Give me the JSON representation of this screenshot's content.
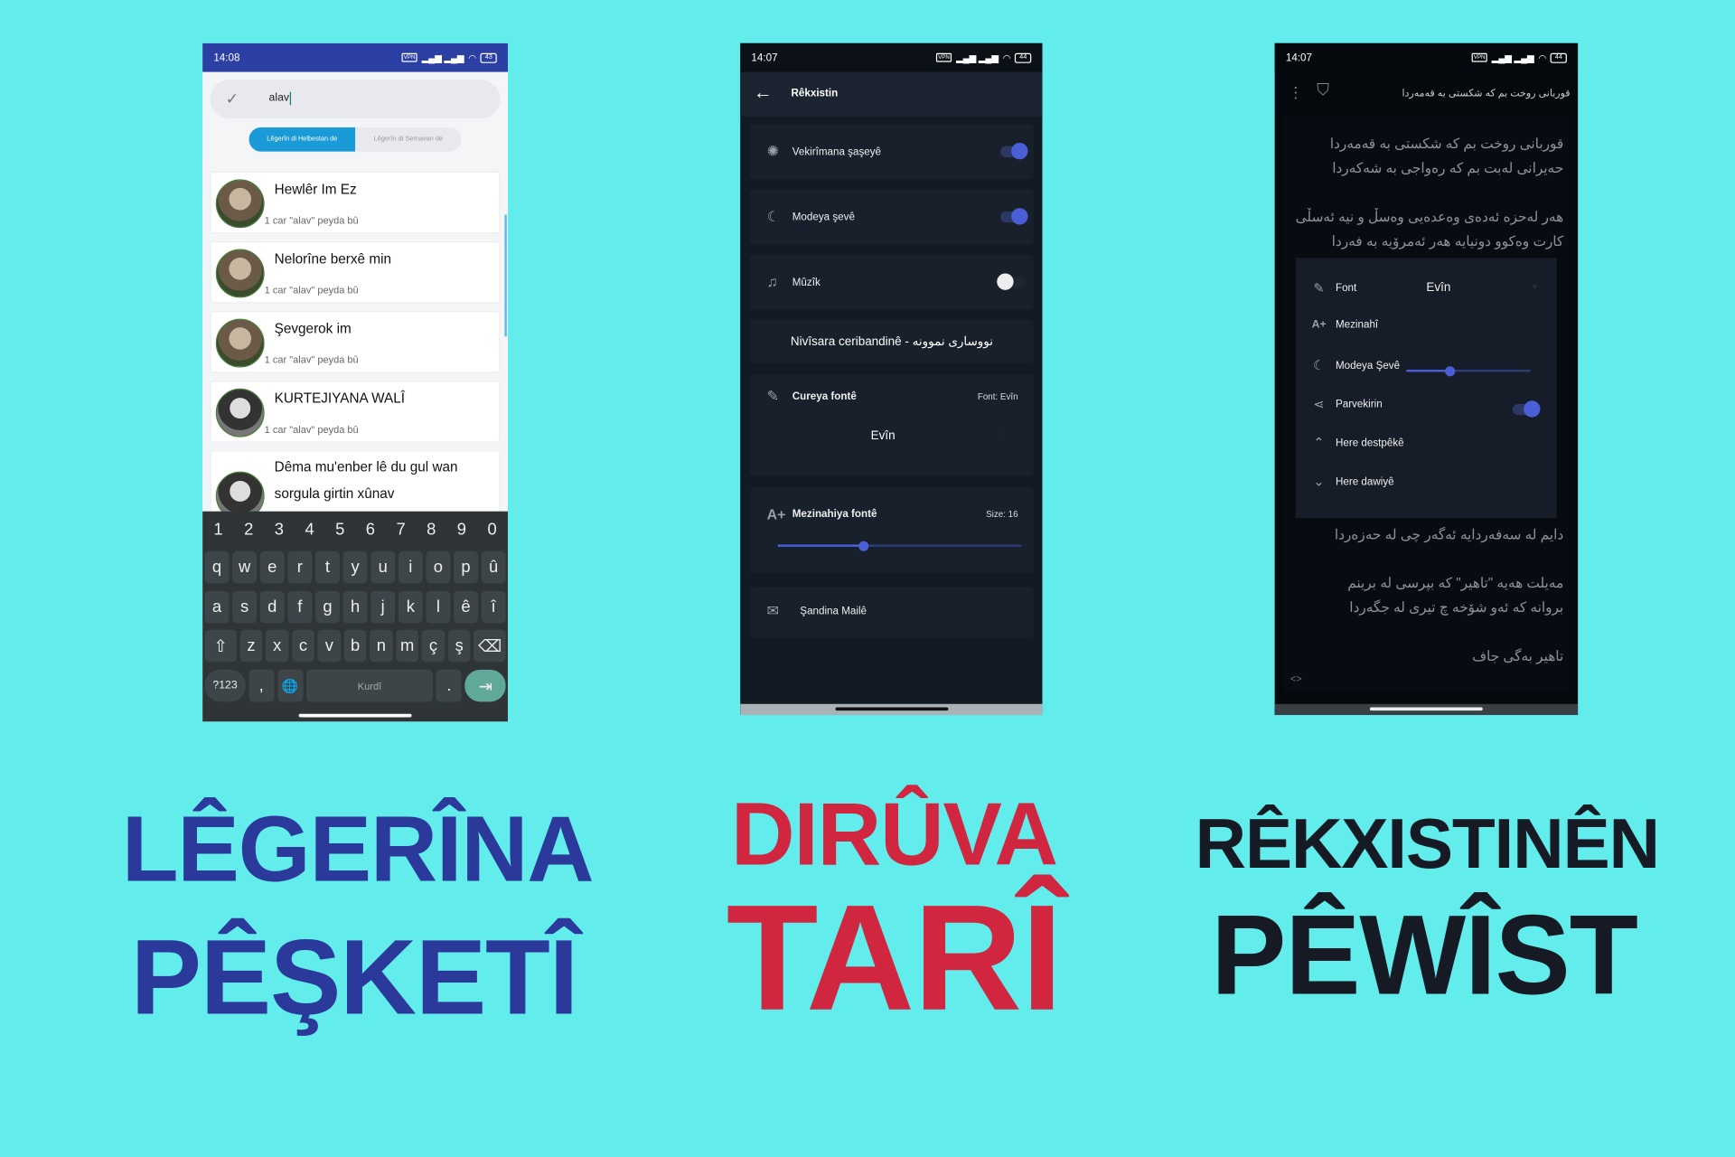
{
  "colors": {
    "background": "#62ecec",
    "blue_title": "#2b3a9a",
    "red_title": "#d0263f",
    "dark_title": "#151a24",
    "accent": "#4a5fd6",
    "search_tab_active": "#1a9ad6"
  },
  "search_screen": {
    "status": {
      "time": "14:08",
      "vpn": "VPN",
      "battery": "43"
    },
    "search": {
      "value": "alav",
      "icon": "check-icon"
    },
    "tabs": [
      {
        "label": "Lêgerîn di Helbestan de",
        "active": true
      },
      {
        "label": "Lêgerîn di Sernavan de",
        "active": false
      }
    ],
    "results": [
      {
        "title": "Hewlêr Im Ez",
        "subtitle": "1 car \"alav\" peyda bû"
      },
      {
        "title": "Nelorîne berxê min",
        "subtitle": "1 car \"alav\" peyda bû"
      },
      {
        "title": "Şevgerok im",
        "subtitle": "1 car \"alav\" peyda bû"
      },
      {
        "title": "KURTEJIYANA WALÎ",
        "subtitle": "1 car \"alav\" peyda bû"
      },
      {
        "title": "Dêma mu'enber lê du gul wan sorgula girtin xûnav",
        "subtitle": ""
      }
    ],
    "keyboard": {
      "numbers": [
        "1",
        "2",
        "3",
        "4",
        "5",
        "6",
        "7",
        "8",
        "9",
        "0"
      ],
      "row1": [
        "q",
        "w",
        "e",
        "r",
        "t",
        "y",
        "u",
        "i",
        "o",
        "p",
        "û"
      ],
      "row2": [
        "a",
        "s",
        "d",
        "f",
        "g",
        "h",
        "j",
        "k",
        "l",
        "ê",
        "î"
      ],
      "row3": [
        "z",
        "x",
        "c",
        "v",
        "b",
        "n",
        "m",
        "ç",
        "ş"
      ],
      "symbols": "?123",
      "comma": ",",
      "space": "Kurdî",
      "period": "."
    }
  },
  "settings_screen": {
    "status": {
      "time": "14:07",
      "vpn": "VPN",
      "battery": "44"
    },
    "title": "Rêkxistin",
    "items": [
      {
        "label": "Vekirîmana şaşeyê",
        "icon": "lightbulb-icon",
        "toggle": true
      },
      {
        "label": "Modeya şevê",
        "icon": "moon-icon",
        "toggle": true
      },
      {
        "label": "Mûzîk",
        "icon": "music-icon",
        "toggle": false
      }
    ],
    "sample_text": "Nivîsara ceribandinê - نووساری نموونە",
    "font_type": {
      "label": "Cureya fontê",
      "value_label": "Font: Evîn",
      "selected": "Evîn",
      "icon": "pencil-icon"
    },
    "font_size": {
      "label": "Mezinahiya fontê",
      "value_label": "Size: 16",
      "slider_fraction": 0.35,
      "icon": "font-size-icon"
    },
    "mail": {
      "label": "Şandina Mailê",
      "icon": "mail-icon"
    }
  },
  "reader_screen": {
    "status": {
      "time": "14:07",
      "vpn": "VPN",
      "battery": "44"
    },
    "title": "قوربانی روخت بم کە شکستی بە قەمەردا",
    "poem": [
      "قوربانی روخت بم کە شکستی بە قەمەردا",
      "حەیرانی لەبت بم کە رەواجی بە شەکەردا",
      "هەر لەحزە ئەدەی وەعدەیی وەسڵ و نیە ئەسڵی",
      "کارت وەکوو دونیایە هەر ئەمرۆیە بە فەردا",
      "دایم لە سەفەردایە ئەگەر چی لە حەزەردا",
      "مەیلت هەیە \"تاهیر\" کە بپرسی لە برینم",
      "بروانە کە ئەو شۆخە چ تیری لە جگەردا",
      "تاهیر بەگی جاف"
    ],
    "code_toggle": "<>",
    "menu": {
      "font_label": "Font",
      "font_value": "Evîn",
      "size_label": "Mezinahî",
      "size_fraction": 0.35,
      "night_label": "Modeya Şevê",
      "night_on": true,
      "share_label": "Parvekirin",
      "top_label": "Here destpêkê",
      "bottom_label": "Here dawiyê"
    }
  },
  "headlines": [
    {
      "line1": "LÊGERÎNA",
      "line2": "PÊŞKETÎ"
    },
    {
      "line1": "DIRÛVA",
      "line2": "TARÎ"
    },
    {
      "line1": "RÊKXISTINÊN",
      "line2": "PÊWÎST"
    }
  ]
}
